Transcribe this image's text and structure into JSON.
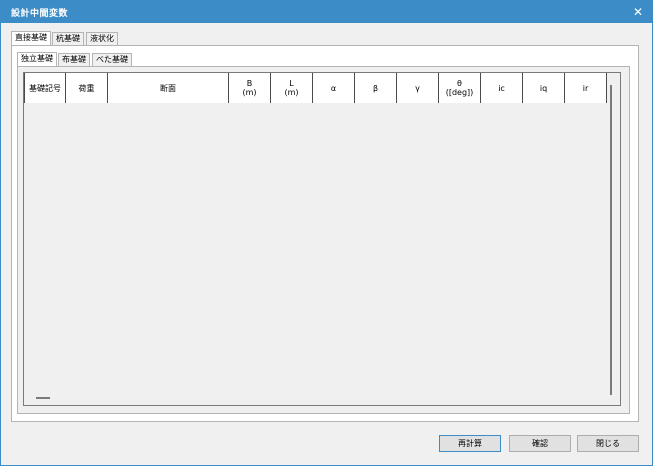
{
  "window": {
    "title": "設計中間変数",
    "close_glyph": "✕"
  },
  "tabs_top": [
    {
      "label": "直接基礎",
      "active": true
    },
    {
      "label": "杭基礎",
      "active": false
    },
    {
      "label": "液状化",
      "active": false
    }
  ],
  "tabs_sub": [
    {
      "label": "独立基礎",
      "active": true
    },
    {
      "label": "布基礎",
      "active": false
    },
    {
      "label": "べた基礎",
      "active": false
    }
  ],
  "grid": {
    "columns": [
      "基礎記号",
      "荷重",
      "断面",
      "B\n(m)",
      "L\n(m)",
      "α",
      "β",
      "γ",
      "θ\n([deg])",
      "ic",
      "iq",
      "ir"
    ],
    "rows": []
  },
  "buttons": {
    "recalc": "再計算",
    "ok": "確認",
    "close": "閉じる"
  },
  "colors": {
    "accent": "#3c8cc8"
  },
  "icons": {
    "close": "close-icon"
  }
}
